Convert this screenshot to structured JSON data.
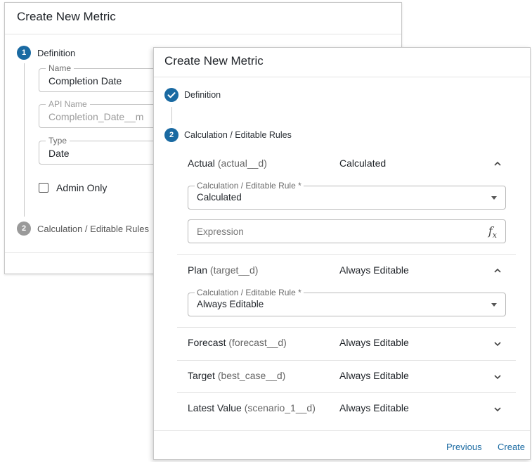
{
  "back_dialog": {
    "title": "Create New Metric",
    "step1": {
      "number": "1",
      "label": "Definition"
    },
    "fields": {
      "name": {
        "legend": "Name",
        "value": "Completion Date"
      },
      "api_name": {
        "legend": "API Name",
        "value": "Completion_Date__m"
      },
      "type": {
        "legend": "Type",
        "value": "Date"
      }
    },
    "admin_only": {
      "label": "Admin Only",
      "checked": false
    },
    "step2": {
      "number": "2",
      "label": "Calculation / Editable Rules"
    }
  },
  "front_dialog": {
    "title": "Create New Metric",
    "step1": {
      "label": "Definition",
      "state": "complete"
    },
    "step2": {
      "number": "2",
      "label": "Calculation / Editable Rules"
    },
    "rows": [
      {
        "name": "Actual",
        "api": "(actual__d)",
        "value": "Calculated",
        "expanded": true,
        "rule_legend": "Calculation / Editable Rule *",
        "rule_value": "Calculated",
        "expression_placeholder": "Expression",
        "expression_icon": "function-icon"
      },
      {
        "name": "Plan",
        "api": "(target__d)",
        "value": "Always Editable",
        "expanded": true,
        "rule_legend": "Calculation / Editable Rule *",
        "rule_value": "Always Editable"
      },
      {
        "name": "Forecast",
        "api": "(forecast__d)",
        "value": "Always Editable",
        "expanded": false
      },
      {
        "name": "Target",
        "api": "(best_case__d)",
        "value": "Always Editable",
        "expanded": false
      },
      {
        "name": "Latest Value",
        "api": "(scenario_1__d)",
        "value": "Always Editable",
        "expanded": false
      }
    ],
    "footer": {
      "previous_label": "Previous",
      "create_label": "Create"
    }
  },
  "colors": {
    "accent": "#1a6aa2",
    "step_inactive": "#9a9a9a",
    "border": "#c4c4c4"
  }
}
